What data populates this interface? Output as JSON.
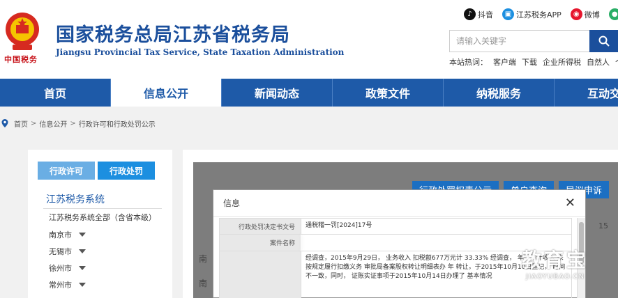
{
  "header": {
    "title": "国家税务总局江苏省税务局",
    "subtitle": "Jiangsu Provincial Tax Service, State Taxation Administration",
    "brand": "中国税务",
    "top_links": [
      {
        "label": "抖音",
        "icon": "douyin-icon",
        "color": "#111111"
      },
      {
        "label": "江苏税务APP",
        "icon": "app-icon",
        "color": "#1c8fe0"
      },
      {
        "label": "微博",
        "icon": "weibo-icon",
        "color": "#e6162d"
      },
      {
        "label": "",
        "icon": "wechat-icon",
        "color": "#2aae67"
      }
    ],
    "search": {
      "placeholder": "请输入关键字"
    },
    "hot_label": "本站热词：",
    "hot_words": [
      "客户端",
      "下载",
      "企业所得税",
      "自然人",
      "个"
    ]
  },
  "nav": {
    "items": [
      "首页",
      "信息公开",
      "新闻动态",
      "政策文件",
      "纳税服务",
      "互动交流"
    ],
    "active_index": 1
  },
  "breadcrumb": {
    "items": [
      "首页",
      "信息公开",
      "行政许可和行政处罚公示"
    ],
    "separator": ">"
  },
  "left_panel": {
    "tabs": [
      "行政许可",
      "行政处罚"
    ],
    "active_tab": 1,
    "system_title": "江苏税务系统",
    "system_all": "江苏税务系统全部（含省本级）",
    "cities": [
      "南京市",
      "无锡市",
      "徐州市",
      "常州市"
    ]
  },
  "right_panel": {
    "buttons": [
      "行政处罚权责公示",
      "单户查询",
      "异议申诉"
    ],
    "bg_rows": [
      "南",
      "南",
      "南"
    ],
    "bg_num": "15"
  },
  "modal": {
    "title": "信息",
    "rows": [
      {
        "key": "行政处罚决定书文号",
        "value": "通税稽一罚[2024]17号"
      },
      {
        "key": "案件名称",
        "value": ""
      },
      {
        "key": "",
        "value": "经调查，2015年9月29日，                    业务收入                                               扣税额677万元计       33.33%    经调查，       年度共计收入 未按规定履行扣缴义务 审批局备案股权转让明细表办 年 转让，于2015年10月10日登记，         时间不一致，同时，            证账实证事项于2015年10月14日办理了           基本情况"
      }
    ],
    "close_icon": "close-icon"
  },
  "watermark": {
    "text": "教育宝",
    "url": "JIAOYUBAO.CN"
  }
}
